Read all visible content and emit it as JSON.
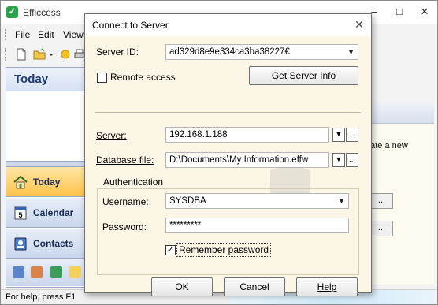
{
  "app": {
    "title": "Efficcess",
    "window_controls": [
      "–",
      "□",
      "✕"
    ],
    "menu": [
      "File",
      "Edit",
      "View"
    ],
    "nav": {
      "header": "Today",
      "buttons": [
        {
          "label": "Today",
          "icon": "home-icon"
        },
        {
          "label": "Calendar",
          "icon": "calendar-icon"
        },
        {
          "label": "Contacts",
          "icon": "contacts-icon"
        }
      ]
    },
    "right_text": "eate a new",
    "right_buttons": [
      "...",
      "..."
    ],
    "status": "For help, press F1"
  },
  "dialog": {
    "title": "Connect to Server",
    "close": "✕",
    "server_id_label": "Server ID:",
    "server_id_value": "ad329d8e9e334ca3ba38227€",
    "remote_access_label": "Remote access",
    "remote_access_checked": false,
    "get_server_info": "Get Server Info",
    "server_label": "Server:",
    "server_value": "192.168.1.188",
    "database_label": "Database file:",
    "database_value": "D:\\Documents\\My Information.effw",
    "browse_label": "...",
    "auth_label": "Authentication",
    "username_label": "Username:",
    "username_value": "SYSDBA",
    "password_label": "Password:",
    "password_value": "*********",
    "remember_label": "Remember password",
    "remember_checked": true,
    "ok": "OK",
    "cancel": "Cancel",
    "help": "Help"
  },
  "colors": {
    "dialog_body": "#fbf6e6",
    "nav_active": "#ffc24a",
    "nav_header_text": "#1e3a73"
  }
}
